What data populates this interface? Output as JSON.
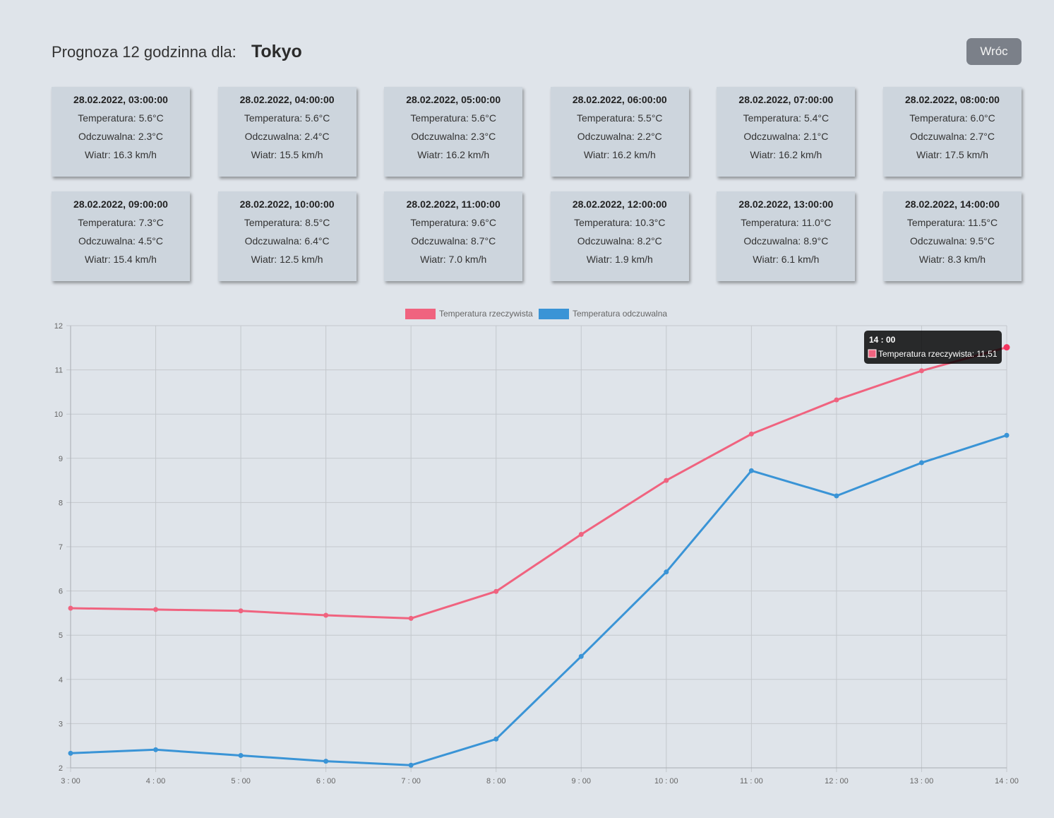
{
  "header": {
    "label": "Prognoza 12 godzinna dla:",
    "city": "Tokyo",
    "back_label": "Wróc"
  },
  "forecast": [
    {
      "time": "28.02.2022, 03:00:00",
      "temp": "Temperatura: 5.6°C",
      "feels": "Odczuwalna: 2.3°C",
      "wind": "Wiatr: 16.3 km/h"
    },
    {
      "time": "28.02.2022, 04:00:00",
      "temp": "Temperatura: 5.6°C",
      "feels": "Odczuwalna: 2.4°C",
      "wind": "Wiatr: 15.5 km/h"
    },
    {
      "time": "28.02.2022, 05:00:00",
      "temp": "Temperatura: 5.6°C",
      "feels": "Odczuwalna: 2.3°C",
      "wind": "Wiatr: 16.2 km/h"
    },
    {
      "time": "28.02.2022, 06:00:00",
      "temp": "Temperatura: 5.5°C",
      "feels": "Odczuwalna: 2.2°C",
      "wind": "Wiatr: 16.2 km/h"
    },
    {
      "time": "28.02.2022, 07:00:00",
      "temp": "Temperatura: 5.4°C",
      "feels": "Odczuwalna: 2.1°C",
      "wind": "Wiatr: 16.2 km/h"
    },
    {
      "time": "28.02.2022, 08:00:00",
      "temp": "Temperatura: 6.0°C",
      "feels": "Odczuwalna: 2.7°C",
      "wind": "Wiatr: 17.5 km/h"
    },
    {
      "time": "28.02.2022, 09:00:00",
      "temp": "Temperatura: 7.3°C",
      "feels": "Odczuwalna: 4.5°C",
      "wind": "Wiatr: 15.4 km/h"
    },
    {
      "time": "28.02.2022, 10:00:00",
      "temp": "Temperatura: 8.5°C",
      "feels": "Odczuwalna: 6.4°C",
      "wind": "Wiatr: 12.5 km/h"
    },
    {
      "time": "28.02.2022, 11:00:00",
      "temp": "Temperatura: 9.6°C",
      "feels": "Odczuwalna: 8.7°C",
      "wind": "Wiatr: 7.0 km/h"
    },
    {
      "time": "28.02.2022, 12:00:00",
      "temp": "Temperatura: 10.3°C",
      "feels": "Odczuwalna: 8.2°C",
      "wind": "Wiatr: 1.9 km/h"
    },
    {
      "time": "28.02.2022, 13:00:00",
      "temp": "Temperatura: 11.0°C",
      "feels": "Odczuwalna: 8.9°C",
      "wind": "Wiatr: 6.1 km/h"
    },
    {
      "time": "28.02.2022, 14:00:00",
      "temp": "Temperatura: 11.5°C",
      "feels": "Odczuwalna: 9.5°C",
      "wind": "Wiatr: 8.3 km/h"
    }
  ],
  "chart_data": {
    "type": "line",
    "categories": [
      "3 : 00",
      "4 : 00",
      "5 : 00",
      "6 : 00",
      "7 : 00",
      "8 : 00",
      "9 : 00",
      "10 : 00",
      "11 : 00",
      "12 : 00",
      "13 : 00",
      "14 : 00"
    ],
    "series": [
      {
        "name": "Temperatura rzeczywista",
        "color": "#f0637f",
        "values": [
          5.61,
          5.58,
          5.55,
          5.45,
          5.38,
          5.99,
          7.28,
          8.5,
          9.55,
          10.32,
          10.98,
          11.51
        ]
      },
      {
        "name": "Temperatura odczuwalna",
        "color": "#3a94d6",
        "values": [
          2.33,
          2.41,
          2.28,
          2.15,
          2.06,
          2.65,
          4.52,
          6.43,
          8.72,
          8.15,
          8.9,
          9.52
        ]
      }
    ],
    "ylim": [
      2,
      12
    ],
    "yticks": [
      2,
      3,
      4,
      5,
      6,
      7,
      8,
      9,
      10,
      11,
      12
    ],
    "grid": true,
    "legend": "top-center",
    "tooltip": {
      "title": "14 : 00",
      "text": "Temperatura rzeczywista: 11,51"
    }
  }
}
